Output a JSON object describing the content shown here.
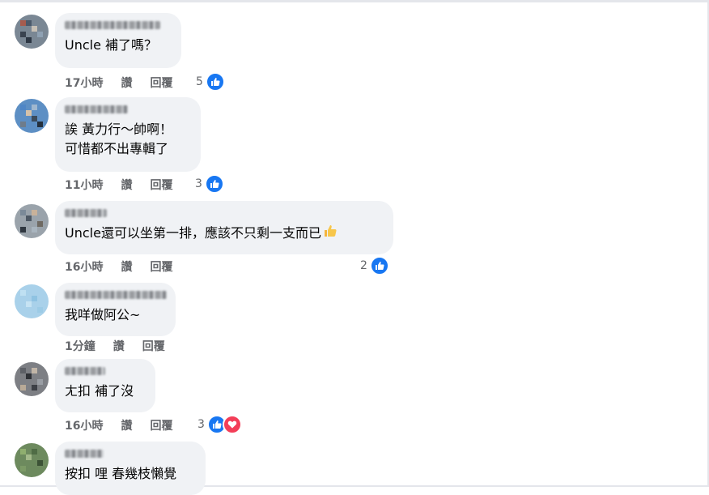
{
  "comments": [
    {
      "text_lines": [
        "Uncle 補了嗎？"
      ],
      "time": "17小時",
      "like": "讚",
      "reply": "回覆",
      "reaction_count": "5",
      "reactions": [
        "like"
      ]
    },
    {
      "text_lines": [
        "誒 黃力行～帥啊！",
        "可惜都不出專輯了"
      ],
      "time": "11小時",
      "like": "讚",
      "reply": "回覆",
      "reaction_count": "3",
      "reactions": [
        "like"
      ]
    },
    {
      "text_lines": [
        "Uncle還可以坐第一排，應該不只剩一支而已"
      ],
      "time": "16小時",
      "like": "讚",
      "reply": "回覆",
      "reaction_count": "2",
      "reactions": [
        "like"
      ]
    },
    {
      "text_lines": [
        "我咩做阿公~"
      ],
      "time": "1分鐘",
      "like": "讚",
      "reply": "回覆",
      "reaction_count": "",
      "reactions": []
    },
    {
      "text_lines": [
        "ㄤ扣 補了沒"
      ],
      "time": "16小時",
      "like": "讚",
      "reply": "回覆",
      "reaction_count": "3",
      "reactions": [
        "like",
        "love"
      ]
    },
    {
      "text_lines": [
        "按扣 哩 春幾枝懶覺"
      ],
      "time": "",
      "like": "",
      "reply": "",
      "reaction_count": "",
      "reactions": []
    }
  ],
  "colors": {
    "bubble": "#f0f2f5",
    "meta_text": "#65676b",
    "like_blue": "#1877f2",
    "love_red": "#f33e58"
  }
}
